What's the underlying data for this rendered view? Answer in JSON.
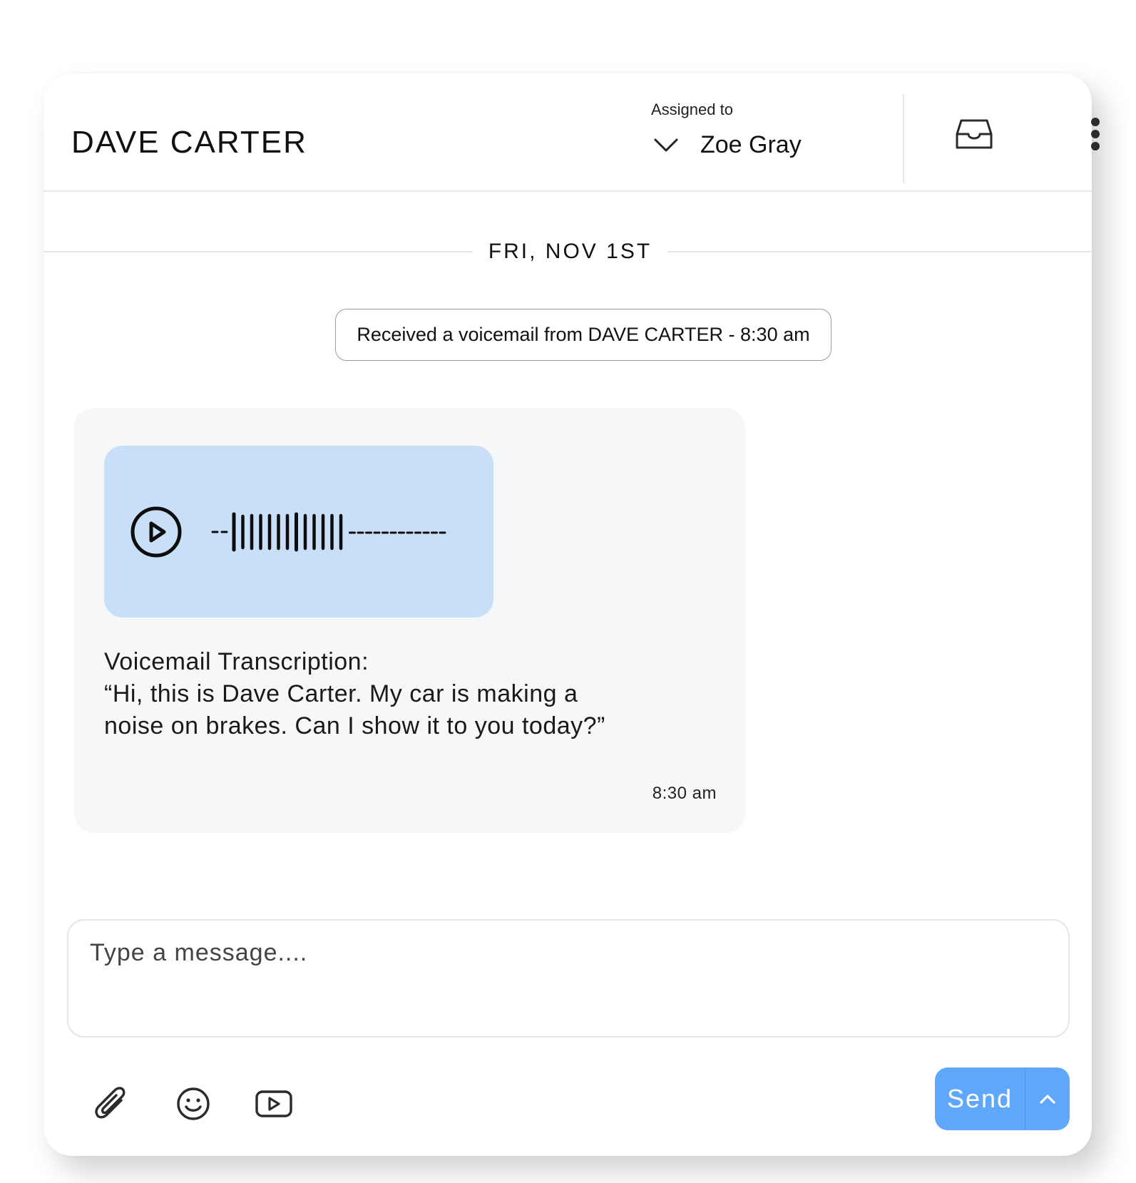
{
  "header": {
    "contact_name": "DAVE CARTER",
    "assigned_label": "Assigned to",
    "assignee": "Zoe Gray",
    "icons": {
      "assign_dropdown": "chevron-down-icon",
      "inbox": "inbox-tray-icon",
      "more": "more-vertical-icon"
    }
  },
  "conversation": {
    "date_divider": "FRI, NOV 1ST",
    "event_notice": "Received a voicemail from DAVE CARTER - 8:30 am",
    "messages": [
      {
        "type": "voicemail",
        "audio": {
          "play_icon": "play-circle-icon",
          "waveform_icon": "waveform-icon"
        },
        "transcription_lines": [
          "Voicemail Transcription:",
          "“Hi, this is Dave Carter. My car is making a",
          "noise on brakes. Can I show it to you today?”"
        ],
        "time": "8:30 am"
      }
    ]
  },
  "composer": {
    "placeholder": "Type a message....",
    "value": "",
    "tools": [
      "paperclip-icon",
      "emoji-smile-icon",
      "video-play-icon"
    ],
    "send_label": "Send",
    "send_more_icon": "chevron-up-icon"
  },
  "colors": {
    "accent": "#5fa7fb",
    "audio_bg": "#c9dff7",
    "bubble_bg": "#f6f7f9",
    "divider": "#e6e6e6"
  }
}
